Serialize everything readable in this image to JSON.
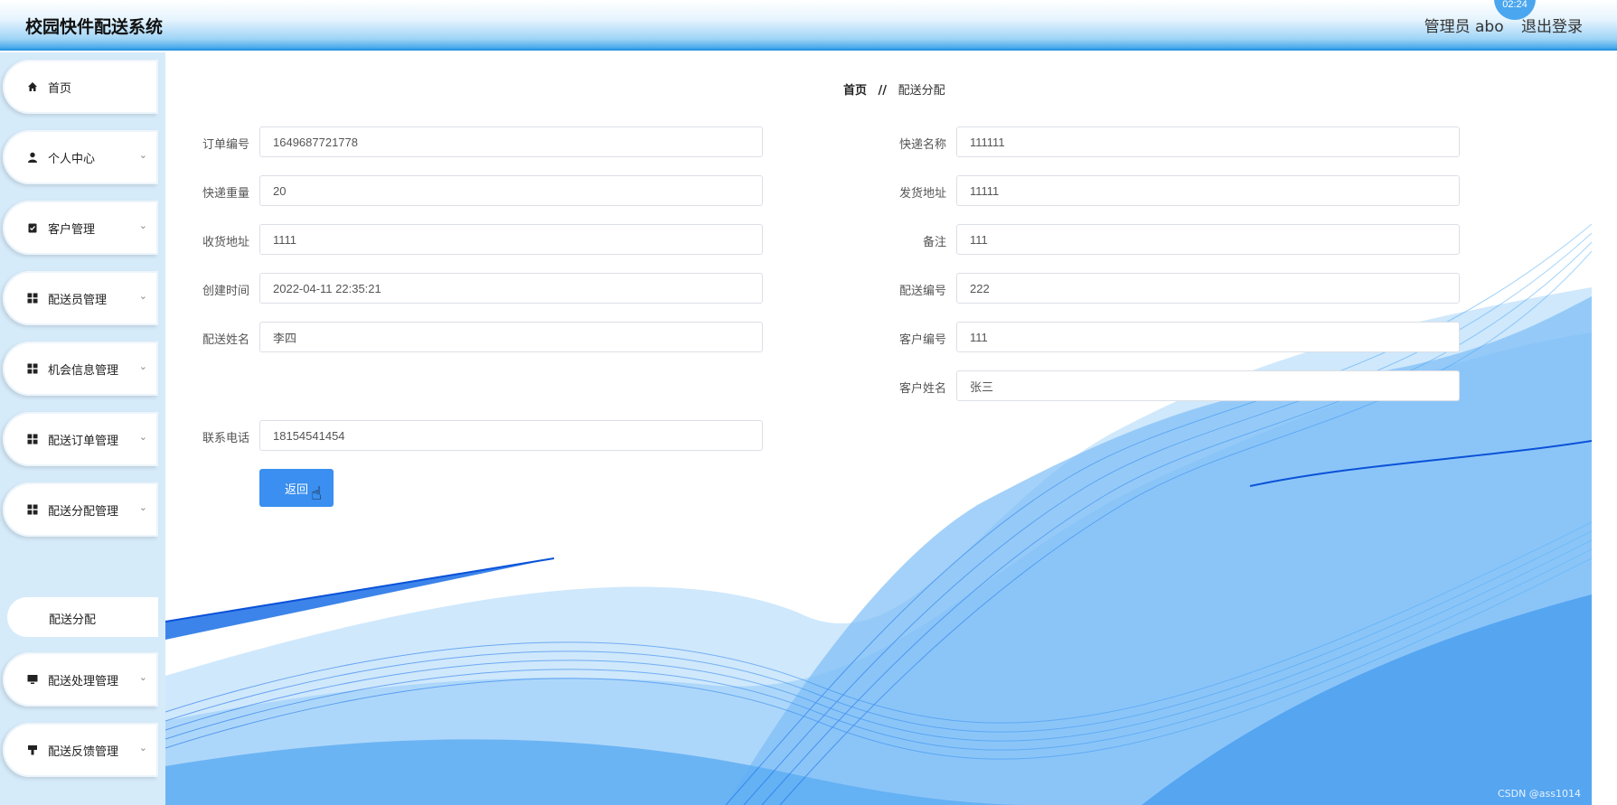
{
  "header": {
    "title": "校园快件配送系统",
    "user_label": "管理员 abo",
    "logout_label": "退出登录",
    "clock_text": "02:24"
  },
  "sidebar": {
    "items": [
      {
        "label": "首页",
        "icon": "home-icon",
        "has_arrow": false
      },
      {
        "label": "个人中心",
        "icon": "user-icon",
        "has_arrow": true
      },
      {
        "label": "客户管理",
        "icon": "clipboard-icon",
        "has_arrow": true
      },
      {
        "label": "配送员管理",
        "icon": "grid-icon",
        "has_arrow": true
      },
      {
        "label": "机会信息管理",
        "icon": "grid-icon",
        "has_arrow": true
      },
      {
        "label": "配送订单管理",
        "icon": "grid-icon",
        "has_arrow": true
      },
      {
        "label": "配送分配管理",
        "icon": "grid-icon",
        "has_arrow": true
      },
      {
        "label": "配送处理管理",
        "icon": "monitor-icon",
        "has_arrow": true
      },
      {
        "label": "配送反馈管理",
        "icon": "stamp-icon",
        "has_arrow": true
      }
    ],
    "sub_item": {
      "label": "配送分配"
    }
  },
  "breadcrumb": {
    "home": "首页",
    "separator": "//",
    "current": "配送分配"
  },
  "form": {
    "order_no": {
      "label": "订单编号",
      "value": "1649687721778"
    },
    "express_name": {
      "label": "快递名称",
      "value": "111111"
    },
    "weight": {
      "label": "快递重量",
      "value": "20"
    },
    "ship_address": {
      "label": "发货地址",
      "value": "11111"
    },
    "recv_address": {
      "label": "收货地址",
      "value": "1111"
    },
    "remark": {
      "label": "备注",
      "value": "111"
    },
    "created": {
      "label": "创建时间",
      "value": "2022-04-11 22:35:21"
    },
    "courier_no": {
      "label": "配送编号",
      "value": "222"
    },
    "courier_name": {
      "label": "配送姓名",
      "value": "李四"
    },
    "customer_no": {
      "label": "客户编号",
      "value": "111"
    },
    "customer_name": {
      "label": "客户姓名",
      "value": "张三"
    },
    "phone": {
      "label": "联系电话",
      "value": "18154541454"
    },
    "back_label": "返回"
  },
  "watermark": "CSDN @ass1014",
  "colors": {
    "accent": "#3a8ff0",
    "sidebar_bg": "#d6ebfa",
    "wave": "#2f8ae8"
  }
}
